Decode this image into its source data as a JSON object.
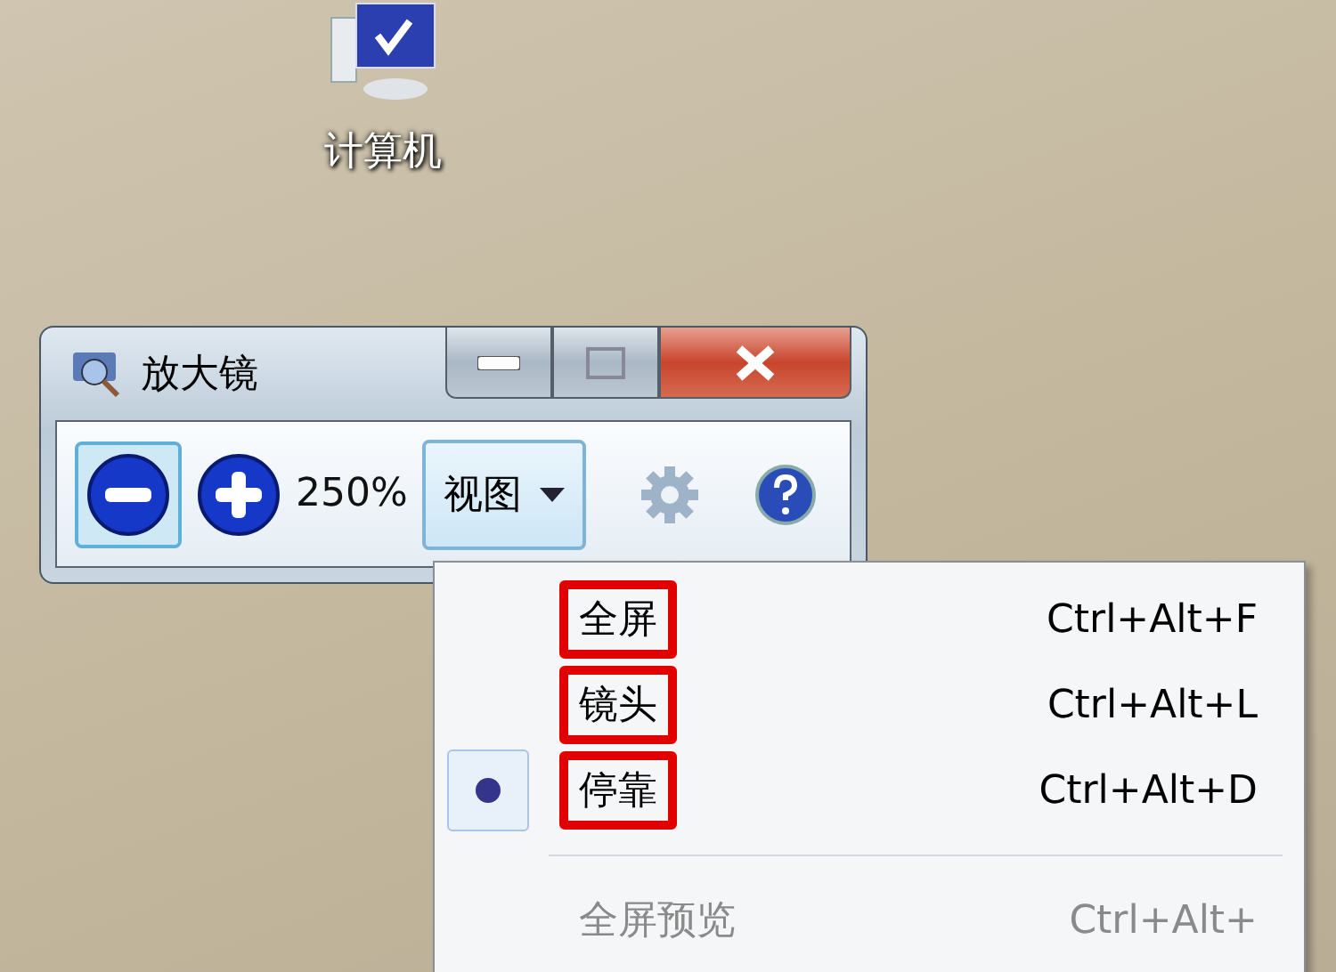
{
  "desktop_icon": {
    "label": "计算机"
  },
  "window": {
    "title": "放大镜"
  },
  "toolbar": {
    "zoom_out": {
      "selected": true
    },
    "zoom_level": "250%",
    "view_button": "视图"
  },
  "menu": {
    "items": [
      {
        "label": "全屏",
        "shortcut": "Ctrl+Alt+F",
        "selected": false,
        "disabled": false,
        "highlighted": true
      },
      {
        "label": "镜头",
        "shortcut": "Ctrl+Alt+L",
        "selected": false,
        "disabled": false,
        "highlighted": true
      },
      {
        "label": "停靠",
        "shortcut": "Ctrl+Alt+D",
        "selected": true,
        "disabled": false,
        "highlighted": true
      },
      {
        "label": "全屏预览",
        "shortcut": "Ctrl+Alt+",
        "selected": false,
        "disabled": true,
        "highlighted": false
      }
    ]
  }
}
